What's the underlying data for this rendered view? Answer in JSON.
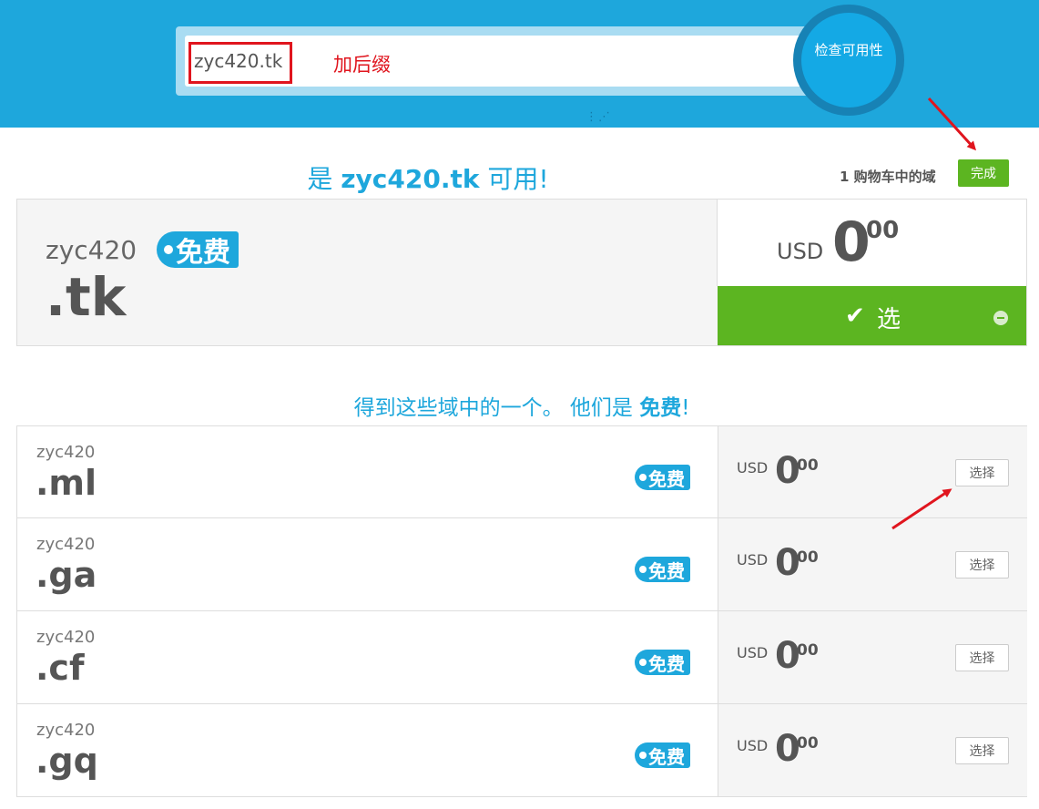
{
  "header": {
    "search_value": "zyc420.tk",
    "annotation_suffix": "加后缀",
    "check_button_label": "检查可用性",
    "dots": "⋮⋰"
  },
  "availability": {
    "prefix": "是 ",
    "domain": "zyc420.tk",
    "suffix": " 可用!"
  },
  "cart": {
    "text": "1 购物车中的域",
    "done_label": "完成"
  },
  "main_result": {
    "sld": "zyc420",
    "tld": ".tk",
    "badge": "免费",
    "currency": "USD",
    "price_int": "0",
    "price_dec": "00",
    "select_label": "选"
  },
  "suggestions": {
    "title_prefix": "得到这些域中的一个。 他们是 ",
    "title_bold": "免费",
    "title_suffix": "!",
    "items": [
      {
        "sld": "zyc420",
        "tld": ".ml",
        "badge": "免费",
        "currency": "USD",
        "price_int": "0",
        "price_dec": "00",
        "button": "选择"
      },
      {
        "sld": "zyc420",
        "tld": ".ga",
        "badge": "免费",
        "currency": "USD",
        "price_int": "0",
        "price_dec": "00",
        "button": "选择"
      },
      {
        "sld": "zyc420",
        "tld": ".cf",
        "badge": "免费",
        "currency": "USD",
        "price_int": "0",
        "price_dec": "00",
        "button": "选择"
      },
      {
        "sld": "zyc420",
        "tld": ".gq",
        "badge": "免费",
        "currency": "USD",
        "price_int": "0",
        "price_dec": "00",
        "button": "选择"
      }
    ]
  },
  "colors": {
    "brand_blue": "#1ea7dc",
    "green": "#5cb521",
    "annotation_red": "#e0151e"
  },
  "icons": [
    "check-icon",
    "remove-icon",
    "red-arrow-icon"
  ]
}
